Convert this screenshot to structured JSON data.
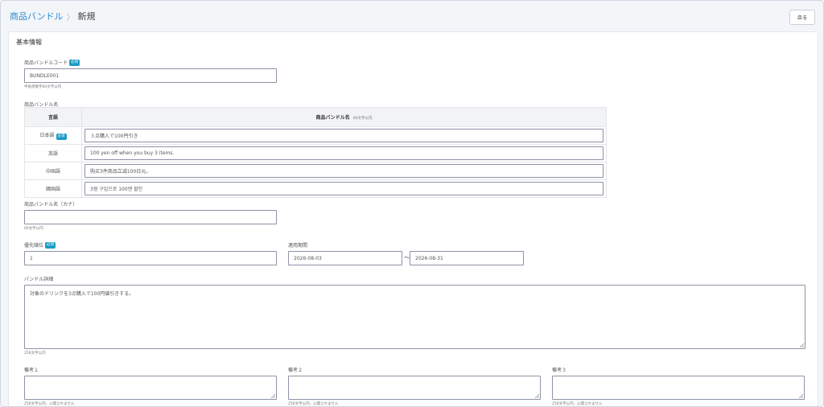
{
  "breadcrumb": {
    "parent": "商品バンドル",
    "separator": "〉",
    "current": "新規"
  },
  "back_button": "戻る",
  "section_title": "基本情報",
  "required_badge": "必須",
  "code": {
    "label": "商品バンドルコード",
    "value": "BUNDLE001",
    "hint": "半角英数字60文字以内"
  },
  "name": {
    "label": "商品バンドル名",
    "col_language": "言語",
    "col_name": "商品バンドル名",
    "col_name_hint": "60文字以内",
    "rows": [
      {
        "language": "日本語",
        "value": "３点購入で100円引き",
        "required": true
      },
      {
        "language": "英語",
        "value": "100 yen off when you buy 3 items.",
        "required": false
      },
      {
        "language": "中国語",
        "value": "购买3件商品立减100日元。",
        "required": false
      },
      {
        "language": "韓国語",
        "value": "3점 구입으로 100엔 할인",
        "required": false
      }
    ]
  },
  "kana": {
    "label": "商品バンドル名（カナ）",
    "value": "",
    "hint": "60文字以内"
  },
  "priority": {
    "label": "優先順位",
    "value": "1"
  },
  "period": {
    "label": "適用期間",
    "start": "2026-08-03",
    "separator": "〜",
    "end": "2026-08-31"
  },
  "detail": {
    "label": "バンドル詳細",
    "value": "対象のドリンクを3点購入で100円値引きする。",
    "hint": "256文字以内"
  },
  "notes": [
    {
      "label": "備考１",
      "value": "",
      "hint": "256文字以内、公開されません"
    },
    {
      "label": "備考２",
      "value": "",
      "hint": "256文字以内、公開されません"
    },
    {
      "label": "備考３",
      "value": "",
      "hint": "256文字以内、公開されません"
    }
  ]
}
